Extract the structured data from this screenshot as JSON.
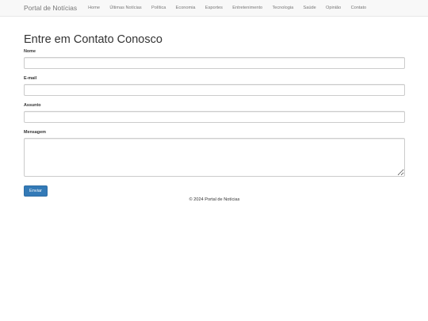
{
  "navbar": {
    "brand": "Portal de Notícias",
    "links": [
      "Home",
      "Últimas Notícias",
      "Política",
      "Economia",
      "Esportes",
      "Entretenimento",
      "Tecnologia",
      "Saúde",
      "Opinião",
      "Contato"
    ]
  },
  "page": {
    "title": "Entre em Contato Conosco"
  },
  "form": {
    "name_label": "Nome",
    "name_value": "",
    "email_label": "E-mail",
    "email_value": "",
    "subject_label": "Assunto",
    "subject_value": "",
    "message_label": "Mensagem",
    "message_value": "",
    "submit_label": "Enviar"
  },
  "footer": {
    "text": "© 2024 Portal de Notícias"
  }
}
